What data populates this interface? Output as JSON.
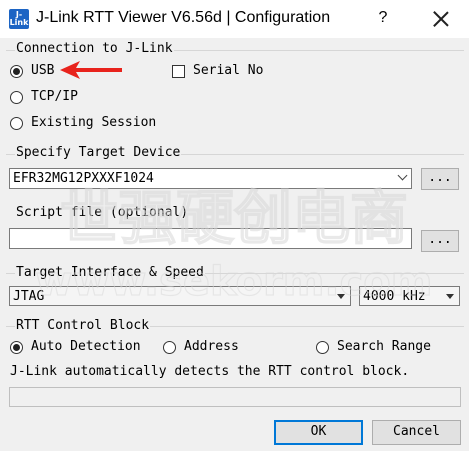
{
  "window": {
    "title": "J-Link RTT Viewer V6.56d | Configuration",
    "icon_text": "J-Link",
    "help_label": "?"
  },
  "connection": {
    "heading": "Connection to J-Link",
    "usb_label": "USB",
    "usb_selected": true,
    "serial_label": "Serial No",
    "serial_checked": false,
    "tcpip_label": "TCP/IP",
    "existing_label": "Existing Session"
  },
  "target_device": {
    "heading": "Specify Target Device",
    "value": "EFR32MG12PXXXF1024",
    "browse_label": "..."
  },
  "script_file": {
    "heading": "Script file (optional)",
    "value": "",
    "browse_label": "..."
  },
  "interface": {
    "heading": "Target Interface & Speed",
    "interface_value": "JTAG",
    "speed_value": "4000 kHz"
  },
  "rtt_block": {
    "heading": "RTT Control Block",
    "auto_label": "Auto Detection",
    "auto_selected": true,
    "address_label": "Address",
    "search_label": "Search Range",
    "description": "J-Link automatically detects the RTT control block.",
    "field_value": ""
  },
  "footer": {
    "ok_label": "OK",
    "cancel_label": "Cancel"
  },
  "watermark": {
    "line1": "世强硬创电商",
    "line2": "www.sekorm.com"
  },
  "colors": {
    "accent": "#0078d7",
    "annotation_arrow": "#e8231c",
    "dialog_bg": "#f0f0f0"
  }
}
